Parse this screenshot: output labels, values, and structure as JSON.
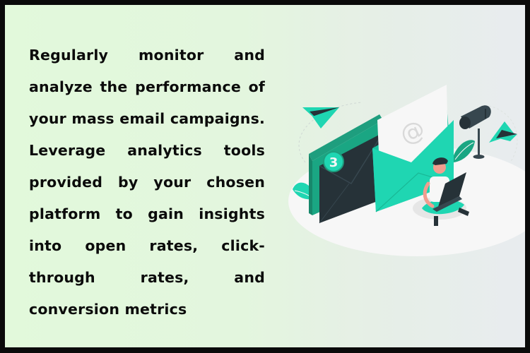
{
  "card": {
    "paragraph": "Regularly monitor and analyze the performance of your mass email campaigns. Leverage analytics tools provided by your chosen platform to gain insights into open rates, click-through rates, and conversion metrics",
    "colors": {
      "border": "#0a0a0a",
      "background_left": "#e2f9db",
      "background_right": "#e8ecef",
      "text": "#0b0b0b",
      "accent_teal": "#1fd6b2",
      "dark_teal": "#1e9e7e",
      "dark_slate": "#263238",
      "paper_white": "#f7f7f7"
    }
  },
  "illustration": {
    "description": "Person with laptop sitting beside email envelopes, mailbox and paper planes",
    "badge_count": "3",
    "at_symbol": "@"
  }
}
